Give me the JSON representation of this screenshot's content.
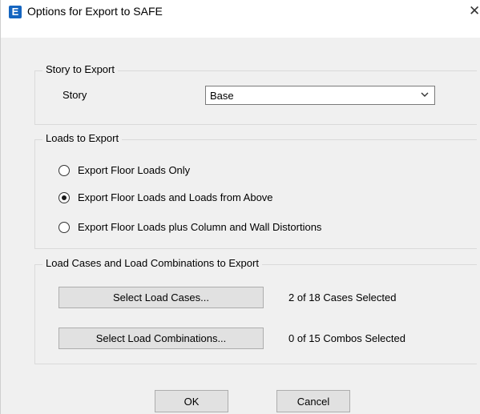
{
  "window": {
    "title": "Options for Export to SAFE",
    "app_icon_letter": "E",
    "close_glyph": "✕",
    "icons": {
      "app": "etabs-app-icon",
      "close": "close-icon"
    }
  },
  "story_section": {
    "title": "Story to Export",
    "story_label": "Story",
    "story_value": "Base",
    "dropdown_icon": "chevron-down-icon"
  },
  "loads_section": {
    "title": "Loads to Export",
    "options": [
      {
        "label": "Export Floor Loads Only",
        "selected": false
      },
      {
        "label": "Export Floor Loads and Loads from Above",
        "selected": true
      },
      {
        "label": "Export Floor Loads plus Column and Wall Distortions",
        "selected": false
      }
    ]
  },
  "combos_section": {
    "title": "Load Cases and Load Combinations to Export",
    "select_cases_label": "Select Load Cases...",
    "cases_status": "2 of 18 Cases Selected",
    "select_combos_label": "Select Load Combinations...",
    "combos_status": "0 of 15 Combos Selected"
  },
  "buttons": {
    "ok": "OK",
    "cancel": "Cancel"
  }
}
